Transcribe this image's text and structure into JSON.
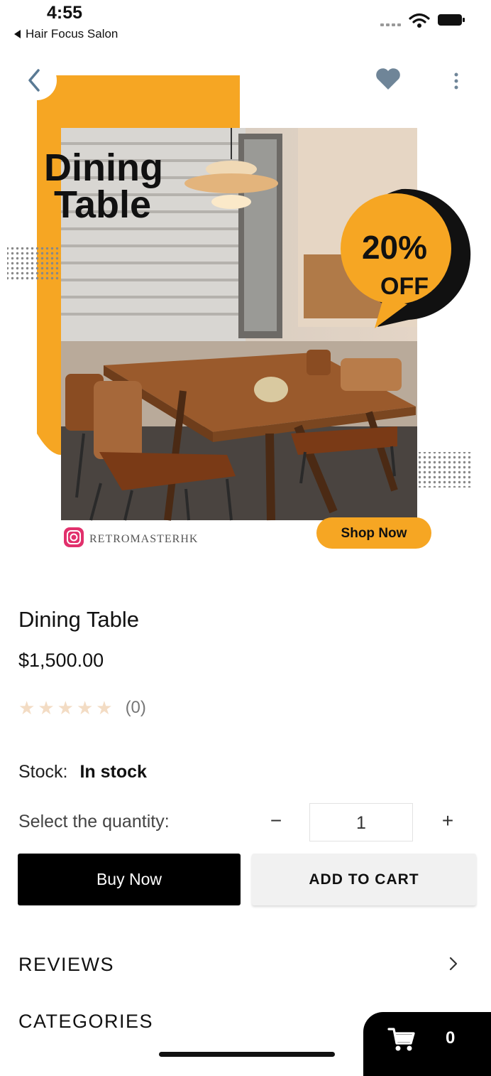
{
  "status_bar": {
    "time": "4:55",
    "back_app": "Hair Focus Salon"
  },
  "nav": {
    "back_icon": "chevron-left-icon",
    "favorite_icon": "heart-icon",
    "more_icon": "more-vertical-icon"
  },
  "hero": {
    "headline_line1": "Dining",
    "headline_line2": "Table",
    "discount_line1": "20%",
    "discount_line2": "OFF",
    "instagram_handle": "RETROMASTERHK",
    "shop_button": "Shop Now",
    "accent_color": "#f6a623"
  },
  "product": {
    "name": "Dining Table",
    "price": "$1,500.00",
    "rating": 0,
    "max_rating": 5,
    "review_count": "(0)",
    "stock_label": "Stock:",
    "stock_value": "In stock"
  },
  "quantity": {
    "label": "Select the quantity:",
    "minus": "−",
    "value": "1",
    "plus": "+"
  },
  "actions": {
    "buy_now": "Buy Now",
    "add_to_cart": "ADD TO CART"
  },
  "sections": {
    "reviews": "REVIEWS",
    "categories": "CATEGORIES"
  },
  "cart": {
    "count": "0",
    "icon": "cart-icon"
  }
}
